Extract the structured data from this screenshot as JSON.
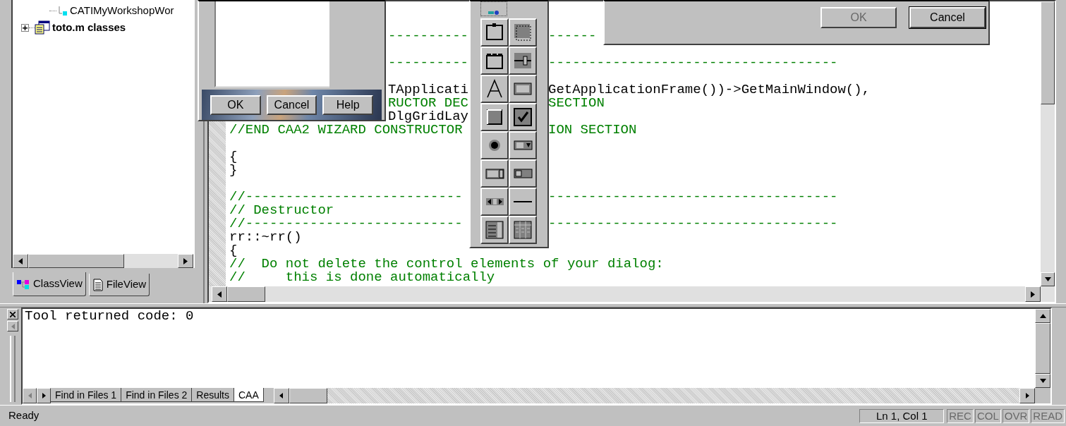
{
  "class_tree": {
    "items": [
      {
        "kind": "interface",
        "label": "CATIMyWorkshopWor"
      },
      {
        "kind": "classes",
        "label": "toto.m classes",
        "expanded": false
      }
    ]
  },
  "workspace_tabs": [
    {
      "label": "ClassView",
      "selected": true
    },
    {
      "label": "FileView",
      "selected": false
    }
  ],
  "editor": {
    "lines": [
      {
        "kind": "comment",
        "clipped": true,
        "a": "----------",
        "b": "------"
      },
      {
        "kind": "blank"
      },
      {
        "kind": "comment",
        "clipped": true,
        "a": "----------",
        "b": "------------------------------------"
      },
      {
        "kind": "blank"
      },
      {
        "kind": "code",
        "clipped": true,
        "a": "TApplicati",
        "b": "GetApplicationFrame())->GetMainWindow(),"
      },
      {
        "kind": "comment",
        "clipped": true,
        "a": "RUCTOR DEC",
        "b": "SECTION"
      },
      {
        "kind": "code",
        "clipped": true,
        "a": "DlgGridLay"
      },
      {
        "kind": "comment",
        "clipped": false,
        "a": "//END CAA2 WIZARD CONSTRUCTOR",
        "b": "ION SECTION"
      },
      {
        "kind": "blank"
      },
      {
        "kind": "code",
        "clipped": false,
        "a": "{"
      },
      {
        "kind": "code",
        "clipped": false,
        "a": "}"
      },
      {
        "kind": "blank"
      },
      {
        "kind": "comment",
        "clipped": false,
        "a": "//---------------------------",
        "b": "------------------------------------"
      },
      {
        "kind": "comment",
        "clipped": false,
        "a": "// Destructor"
      },
      {
        "kind": "comment",
        "clipped": false,
        "a": "//---------------------------",
        "b": "------------------------------------"
      },
      {
        "kind": "code",
        "clipped": false,
        "a": "rr::~rr()"
      },
      {
        "kind": "code",
        "clipped": false,
        "a": "{"
      },
      {
        "kind": "comment",
        "clipped": false,
        "a": "//  Do not delete the control elements of your dialog:"
      },
      {
        "kind": "comment",
        "clipped": false,
        "a": "//     this is done automatically"
      }
    ]
  },
  "preview_dialog": {
    "buttons": [
      "OK",
      "Cancel",
      "Help"
    ]
  },
  "top_dialog": {
    "buttons": [
      {
        "label": "OK",
        "disabled": true
      },
      {
        "label": "Cancel",
        "disabled": false
      }
    ]
  },
  "output": {
    "text": "Tool returned code: 0",
    "tabs": [
      {
        "label": "Find in Files 1",
        "selected": false
      },
      {
        "label": "Find in Files 2",
        "selected": false
      },
      {
        "label": "Results",
        "selected": false
      },
      {
        "label": "CAA",
        "selected": true
      }
    ]
  },
  "status_bar": {
    "message": "Ready",
    "position": "Ln 1, Col 1",
    "indicators": [
      {
        "label": "REC",
        "disabled": true
      },
      {
        "label": "COL",
        "disabled": true
      },
      {
        "label": "OVR",
        "disabled": true
      },
      {
        "label": "READ",
        "disabled": true
      }
    ]
  }
}
